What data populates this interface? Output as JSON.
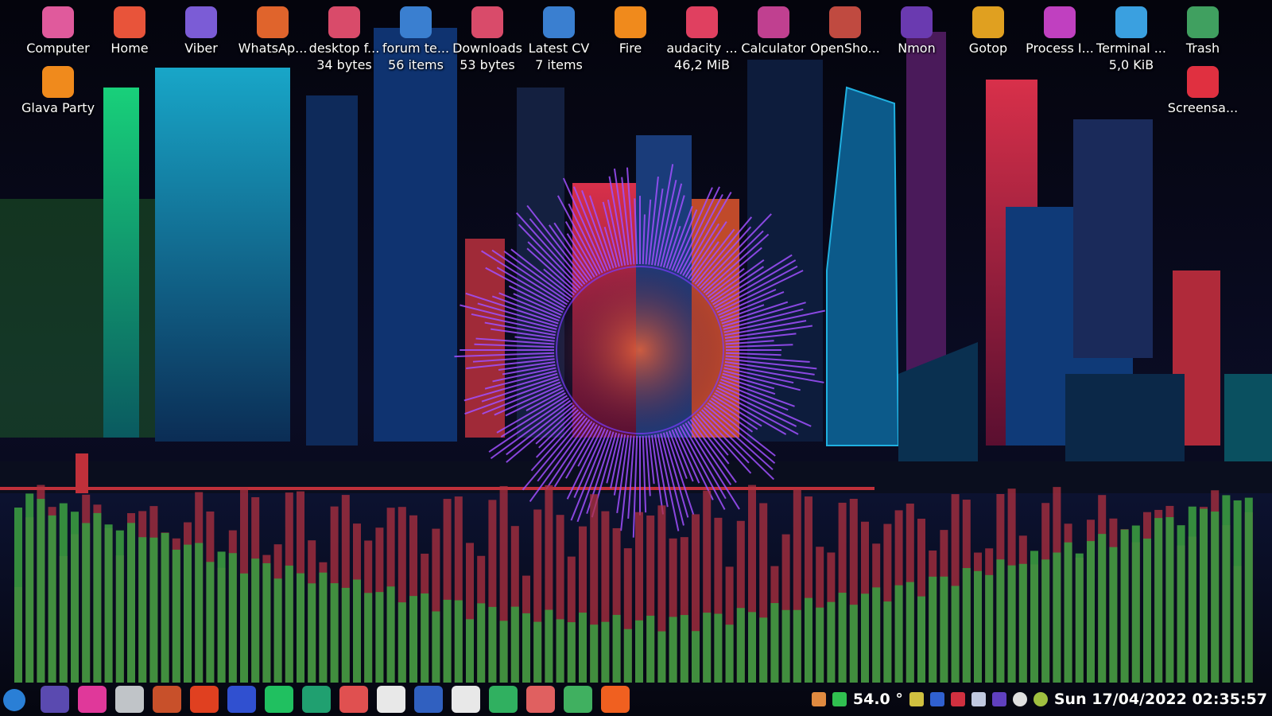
{
  "desktop": {
    "icons": [
      {
        "label": "Computer",
        "sub": "",
        "icon": "monitor-icon",
        "color": "#e05a9c"
      },
      {
        "label": "Home",
        "sub": "",
        "icon": "home-folder-icon",
        "color": "#e8543a"
      },
      {
        "label": "Viber",
        "sub": "",
        "icon": "viber-icon",
        "color": "#7b5cd6"
      },
      {
        "label": "WhatsAp...",
        "sub": "",
        "icon": "whatsapp-icon",
        "color": "#e0642c"
      },
      {
        "label": "desktop f...",
        "sub": "34 bytes",
        "icon": "desktop-file-icon",
        "color": "#d94b6a"
      },
      {
        "label": "forum te...",
        "sub": "56 items",
        "icon": "folder-icon",
        "color": "#3a7fd0"
      },
      {
        "label": "Downloads",
        "sub": "53 bytes",
        "icon": "downloads-icon",
        "color": "#d94b6a"
      },
      {
        "label": "Latest CV",
        "sub": "7 items",
        "icon": "folder-icon",
        "color": "#3a7fd0"
      },
      {
        "label": "Fire",
        "sub": "",
        "icon": "fire-icon",
        "color": "#f08a1c"
      },
      {
        "label": "audacity ...",
        "sub": "46,2 MiB",
        "icon": "package-icon",
        "color": "#e04060"
      },
      {
        "label": "Calculator",
        "sub": "",
        "icon": "calculator-icon",
        "color": "#c04090"
      },
      {
        "label": "OpenSho...",
        "sub": "",
        "icon": "video-editor-icon",
        "color": "#c04a40"
      },
      {
        "label": "Nmon",
        "sub": "",
        "icon": "monitor-graph-icon",
        "color": "#6a3ab0"
      },
      {
        "label": "Gotop",
        "sub": "",
        "icon": "gear-color-icon",
        "color": "#e0a020"
      },
      {
        "label": "Process I...",
        "sub": "",
        "icon": "process-icon",
        "color": "#c040c0"
      },
      {
        "label": "Terminal ...",
        "sub": "5,0 KiB",
        "icon": "text-file-icon",
        "color": "#3aa0e0"
      },
      {
        "label": "Trash",
        "sub": "",
        "icon": "trash-icon",
        "color": "#40a060"
      },
      {
        "label": "Glava Party",
        "sub": "",
        "icon": "glava-icon",
        "color": "#f08a1c"
      },
      {
        "label": "Screensa...",
        "sub": "",
        "icon": "screensaver-icon",
        "color": "#e03040"
      }
    ]
  },
  "panel": {
    "launchers": [
      {
        "name": "menu-icon",
        "color": "#2a7fd6"
      },
      {
        "name": "files-icon",
        "color": "#5a4ab0"
      },
      {
        "name": "archive-icon",
        "color": "#e0389a"
      },
      {
        "name": "disk-icon",
        "color": "#c0c4c8"
      },
      {
        "name": "cpu-icon",
        "color": "#c8502a"
      },
      {
        "name": "lightning-icon",
        "color": "#e04020"
      },
      {
        "name": "video-icon",
        "color": "#3050d0"
      },
      {
        "name": "music-icon",
        "color": "#20c060"
      },
      {
        "name": "refresh-icon",
        "color": "#20a070"
      },
      {
        "name": "terminal-icon",
        "color": "#e05050"
      },
      {
        "name": "keyboard-icon",
        "color": "#e8e8e8"
      },
      {
        "name": "screenshot-icon",
        "color": "#3060c0"
      },
      {
        "name": "amazon-icon",
        "color": "#e8e8e8"
      },
      {
        "name": "radio-icon",
        "color": "#30b060"
      },
      {
        "name": "terminal-icon",
        "color": "#e06060"
      },
      {
        "name": "mail-icon",
        "color": "#40b060"
      },
      {
        "name": "firefox-icon",
        "color": "#f06020"
      }
    ],
    "tray": {
      "temperature": "54.0 °",
      "clock": "Sun 17/04/2022 02:35:57",
      "icons": [
        "music-note-icon",
        "network-icon",
        "thermometer-icon",
        "battery-icon",
        "bluetooth-icon",
        "shield-icon",
        "flag-icon",
        "vpn-icon",
        "updates-icon",
        "settings-icon"
      ]
    }
  }
}
